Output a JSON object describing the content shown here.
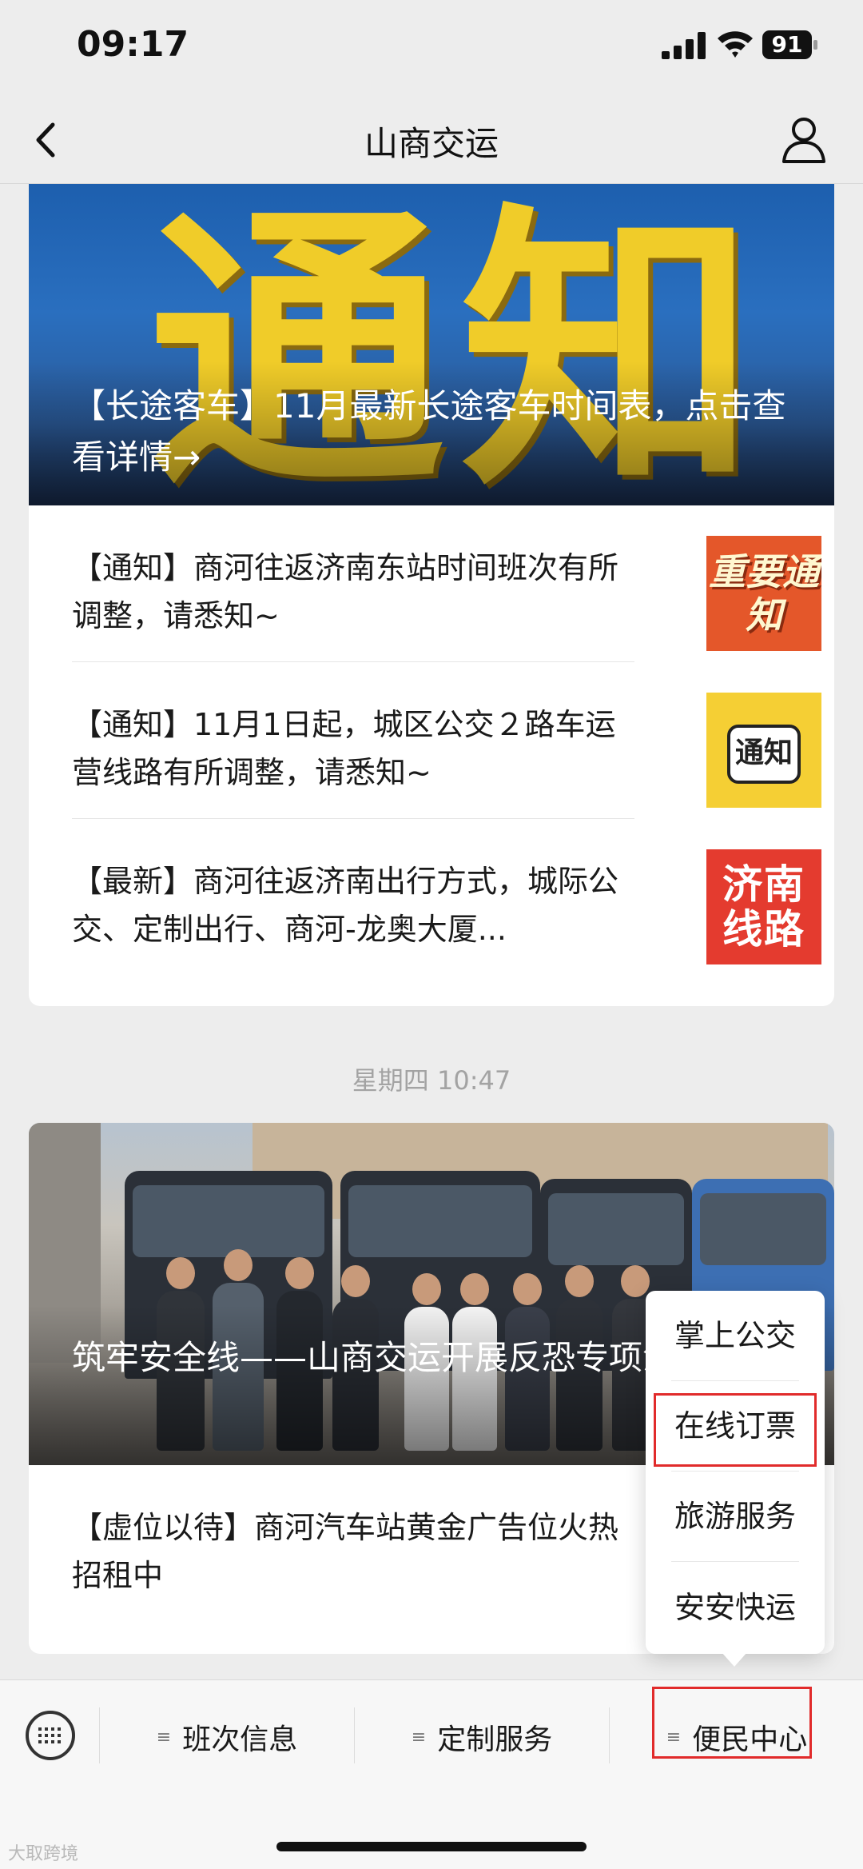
{
  "status_bar": {
    "time": "09:17",
    "battery": "91"
  },
  "nav": {
    "title": "山商交运"
  },
  "card1": {
    "banner_big_text": "通知",
    "banner_caption": "【长途客车】11月最新长途客车时间表，点击查看详情→",
    "items": [
      {
        "title": "【通知】商河往返济南东站时间班次有所调整，请悉知~",
        "thumb_text": "重要通知"
      },
      {
        "title": "【通知】11月1日起，城区公交２路车运营线路有所调整，请悉知~",
        "thumb_text": "通知"
      },
      {
        "title": "【最新】商河往返济南出行方式，城际公交、定制出行、商河-龙奥大厦...",
        "thumb_text": "济南线路"
      }
    ]
  },
  "timestamp": "星期四 10:47",
  "card2": {
    "banner_caption": "筑牢安全线——山商交运开展反恐专项演练",
    "item_title": "【虚位以待】商河汽车站黄金广告位火热招租中"
  },
  "popup_menu": {
    "items": [
      "掌上公交",
      "在线订票",
      "旅游服务",
      "安安快运"
    ]
  },
  "bottom_menu": {
    "tabs": [
      "班次信息",
      "定制服务",
      "便民中心"
    ]
  },
  "watermark": "大取跨境",
  "colors": {
    "highlight": "#e12b2b",
    "banner_gold": "#f0cc29"
  }
}
